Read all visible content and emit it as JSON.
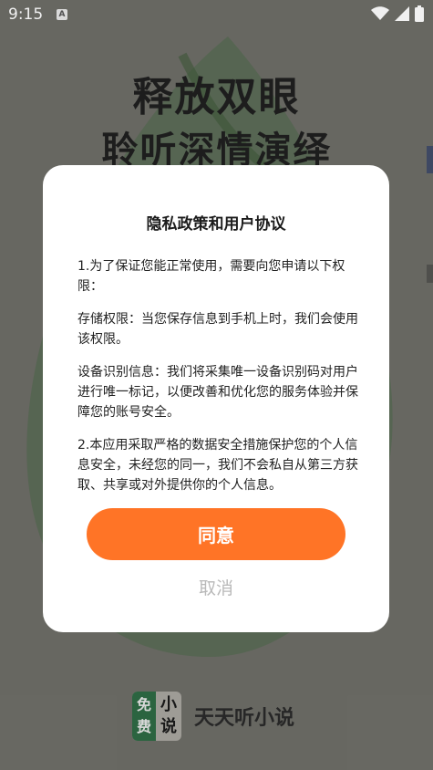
{
  "status_bar": {
    "time": "9:15",
    "app_icon_letter": "A",
    "icons": [
      "wifi-icon",
      "signal-icon",
      "battery-icon"
    ]
  },
  "splash": {
    "title_line1": "释放双眼",
    "title_line2": "聆听深情演绎",
    "brand_logo_left": "免费",
    "brand_logo_right": "小说",
    "brand_name": "天天听小说"
  },
  "dialog": {
    "title": "隐私政策和用户协议",
    "paragraphs": [
      "1.为了保证您能正常使用，需要向您申请以下权限：",
      "存储权限：当您保存信息到手机上时，我们会使用该权限。",
      "设备识别信息：我们将采集唯一设备识别码对用户进行唯一标记，以便改善和优化您的服务体验并保障您的账号安全。",
      "2.本应用采取严格的数据安全措施保护您的个人信息安全，未经您的同一，我们不会私自从第三方获取、共享或对外提供你的个人信息。"
    ],
    "agree_label": "同意",
    "cancel_label": "取消"
  },
  "colors": {
    "accent": "#ff7426",
    "background": "#6e6e68",
    "leaf": "#4f6b4a"
  }
}
